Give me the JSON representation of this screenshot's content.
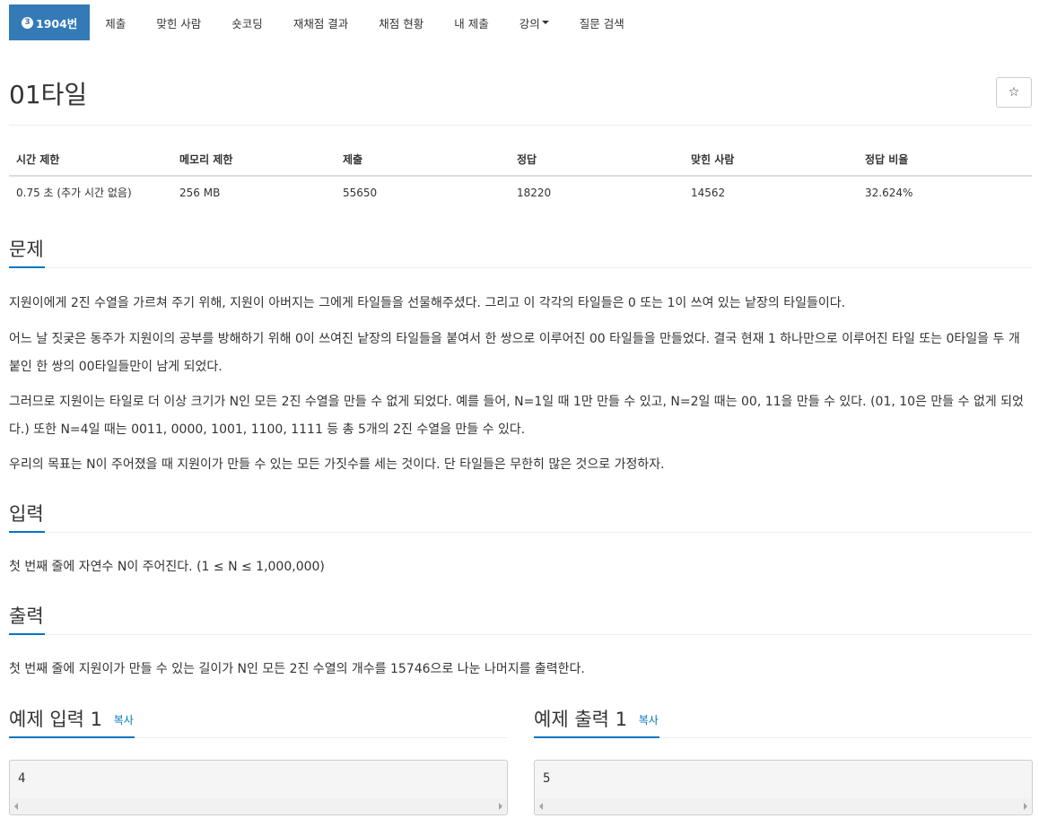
{
  "nav": {
    "problem_number": "1904번",
    "problem_icon": "3",
    "items": [
      "제출",
      "맞힌 사람",
      "숏코딩",
      "재채점 결과",
      "채점 현황",
      "내 제출",
      "강의",
      "질문 검색"
    ]
  },
  "problem": {
    "title": "01타일",
    "star_icon": "☆"
  },
  "info": {
    "headers": [
      "시간 제한",
      "메모리 제한",
      "제출",
      "정답",
      "맞힌 사람",
      "정답 비율"
    ],
    "values": [
      "0.75 초 (추가 시간 없음)",
      "256 MB",
      "55650",
      "18220",
      "14562",
      "32.624%"
    ]
  },
  "sections": {
    "problem_heading": "문제",
    "problem_paragraphs": [
      "지원이에게 2진 수열을 가르쳐 주기 위해, 지원이 아버지는 그에게 타일들을 선물해주셨다. 그리고 이 각각의 타일들은 0 또는 1이 쓰여 있는 낱장의 타일들이다.",
      "어느 날 짓궂은 동주가 지원이의 공부를 방해하기 위해 0이 쓰여진 낱장의 타일들을 붙여서 한 쌍으로 이루어진 00 타일들을 만들었다. 결국 현재 1 하나만으로 이루어진 타일 또는 0타일을 두 개 붙인 한 쌍의 00타일들만이 남게 되었다.",
      "그러므로 지원이는 타일로 더 이상 크기가 N인 모든 2진 수열을 만들 수 없게 되었다. 예를 들어, N=1일 때 1만 만들 수 있고, N=2일 때는 00, 11을 만들 수 있다. (01, 10은 만들 수 없게 되었다.) 또한 N=4일 때는 0011, 0000, 1001, 1100, 1111 등 총 5개의 2진 수열을 만들 수 있다.",
      "우리의 목표는 N이 주어졌을 때 지원이가 만들 수 있는 모든 가짓수를 세는 것이다. 단 타일들은 무한히 많은 것으로 가정하자."
    ],
    "input_heading": "입력",
    "input_text": "첫 번째 줄에 자연수 N이 주어진다. (1 ≤ N ≤ 1,000,000)",
    "output_heading": "출력",
    "output_text": "첫 번째 줄에 지원이가 만들 수 있는 길이가 N인 모든 2진 수열의 개수를 15746으로 나눈 나머지를 출력한다."
  },
  "samples": {
    "input_heading": "예제 입력 1",
    "output_heading": "예제 출력 1",
    "copy_label": "복사",
    "input_value": "4",
    "output_value": "5"
  },
  "colors": {
    "accent": "#0076c0",
    "nav_active": "#337ab7"
  }
}
